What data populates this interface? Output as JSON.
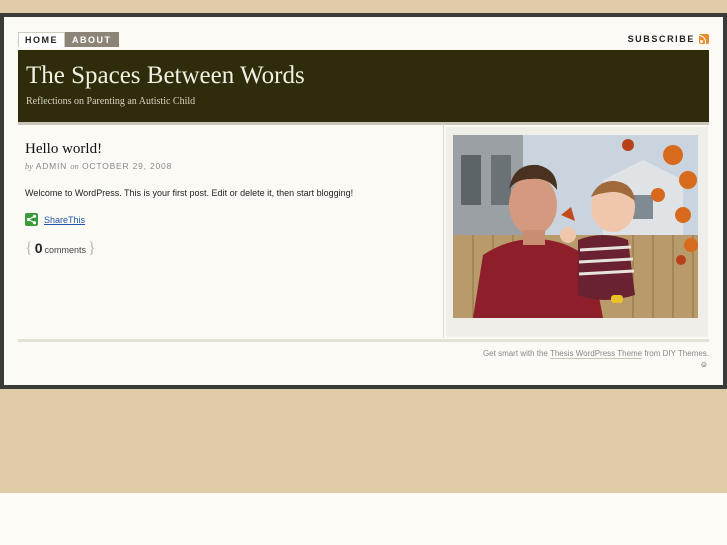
{
  "nav": {
    "items": [
      {
        "label": "HOME"
      },
      {
        "label": "ABOUT"
      }
    ],
    "subscribe_label": "SUBSCRIBE",
    "rss_icon": "rss-icon"
  },
  "header": {
    "title": "The Spaces Between Words",
    "tagline": "Reflections on Parenting an Autistic Child"
  },
  "post": {
    "title": "Hello world!",
    "byline_by": "by",
    "author": "ADMIN",
    "byline_on": "on",
    "date": "OCTOBER 29, 2008",
    "body": "Welcome to WordPress. This is your first post. Edit or delete it, then start blogging!",
    "share_label": "ShareThis",
    "comment_count": "0",
    "comments_label": "comments"
  },
  "footer": {
    "prefix": "Get smart with the",
    "theme_link": "Thesis WordPress Theme",
    "middle": "from",
    "company_link": "DIY Themes.",
    "smiley": "☺"
  },
  "colors": {
    "background": "#e0cba9",
    "header_bg": "#2e2c0b",
    "nav_active": "#8c8577",
    "link": "#2255aa",
    "share_green": "#3a9a3a",
    "rss_orange": "#e78a2a"
  }
}
